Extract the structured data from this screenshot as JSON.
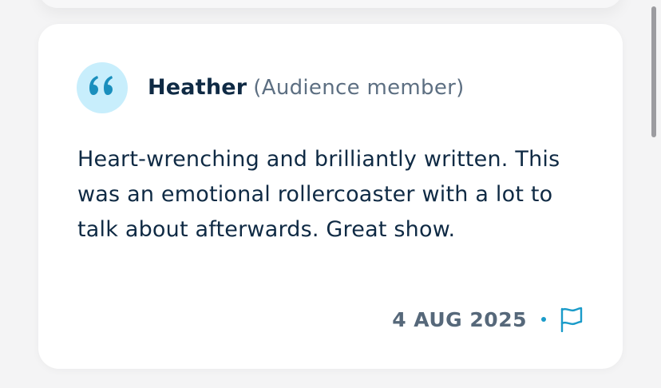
{
  "review": {
    "author_name": "Heather",
    "author_role": "(Audience member)",
    "quote_icon": "quote-icon",
    "text": "Heart-wrenching and brilliantly written. This was an emotional rollercoaster with a lot to talk about afterwards. Great show.",
    "date": "4 AUG 2025",
    "report_icon": "flag-icon"
  },
  "colors": {
    "avatar_bg": "#c8eefc",
    "accent": "#1a9bc9",
    "text_primary": "#0f2a44",
    "text_secondary": "#5d6f82"
  }
}
